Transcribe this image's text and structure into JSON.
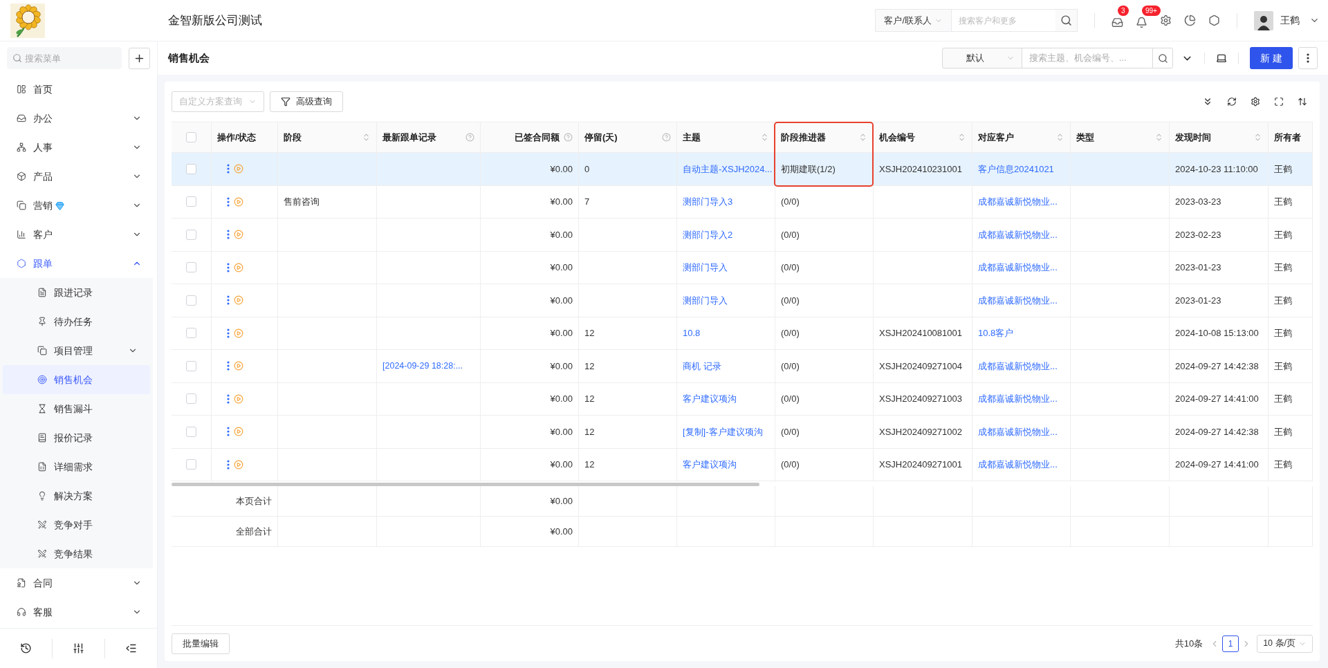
{
  "header": {
    "title": "金智新版公司测试",
    "search_scope": "客户/联系人",
    "search": {
      "placeholder": "搜索客户和更多"
    },
    "notifications": [
      {
        "count": "3"
      },
      {
        "count": "99+"
      }
    ],
    "user": {
      "name": "王鹤"
    }
  },
  "sidebar": {
    "search": {
      "placeholder": "搜索菜单"
    },
    "items": [
      {
        "label": "首页",
        "selected": false
      },
      {
        "label": "办公",
        "selected": false,
        "expanded": false
      },
      {
        "label": "人事",
        "selected": false,
        "expanded": false
      },
      {
        "label": "产品",
        "selected": false,
        "expanded": false
      },
      {
        "label": "营销",
        "selected": false,
        "expanded": false
      },
      {
        "label": "客户",
        "selected": false,
        "expanded": false
      },
      {
        "label": "跟单",
        "selected": false,
        "expanded": true,
        "children": [
          {
            "label": "跟进记录",
            "selected": false
          },
          {
            "label": "待办任务",
            "selected": false
          },
          {
            "label": "项目管理",
            "selected": false,
            "expanded": false
          },
          {
            "label": "销售机会",
            "selected": true
          },
          {
            "label": "销售漏斗",
            "selected": false
          },
          {
            "label": "报价记录",
            "selected": false
          },
          {
            "label": "详细需求",
            "selected": false
          },
          {
            "label": "解决方案",
            "selected": false
          },
          {
            "label": "竞争对手",
            "selected": false
          },
          {
            "label": "竞争结果",
            "selected": false
          }
        ]
      },
      {
        "label": "合同",
        "selected": false,
        "expanded": false
      },
      {
        "label": "客服",
        "selected": false,
        "expanded": false
      }
    ]
  },
  "page": {
    "title": "销售机会",
    "view_select": "默认",
    "search": {
      "placeholder": "搜索主题、机会编号、..."
    },
    "new_button": "新 建"
  },
  "toolbar": {
    "scheme_select": {
      "placeholder": "自定义方案查询"
    },
    "advanced_query": "高级查询"
  },
  "table": {
    "select_all": {
      "checked": false
    },
    "columns": [
      {
        "label": "操作/状态"
      },
      {
        "label": "阶段",
        "sortable": true
      },
      {
        "label": "最新跟单记录",
        "help": true
      },
      {
        "label": "已签合同额",
        "help": true
      },
      {
        "label": "停留(天)",
        "help": true
      },
      {
        "label": "主题",
        "sortable": true
      },
      {
        "label": "阶段推进器",
        "sortable": true,
        "highlighted": true
      },
      {
        "label": "机会编号",
        "sortable": true
      },
      {
        "label": "对应客户",
        "sortable": true
      },
      {
        "label": "类型",
        "sortable": true
      },
      {
        "label": "发现时间",
        "sortable": true
      },
      {
        "label": "所有者"
      }
    ],
    "rows": [
      {
        "selected": true,
        "checked": false,
        "amount": "¥0.00",
        "stay_days": "0",
        "subject": "自动主题-XSJH2024...",
        "stage_progress": "初期建联(1/2)",
        "opportunity_no": "XSJH202410231001",
        "customer": "客户信息20241021",
        "found_time": "2024-10-23 11:10:00",
        "owner": "王鹤"
      },
      {
        "selected": false,
        "checked": false,
        "stage": "售前咨询",
        "amount": "¥0.00",
        "stay_days": "7",
        "subject": "测部门导入3",
        "stage_progress": "(0/0)",
        "customer": "成都嘉诚新悦物业...",
        "found_time": "2023-03-23",
        "owner": "王鹤"
      },
      {
        "selected": false,
        "checked": false,
        "amount": "¥0.00",
        "subject": "测部门导入2",
        "stage_progress": "(0/0)",
        "customer": "成都嘉诚新悦物业...",
        "found_time": "2023-02-23",
        "owner": "王鹤"
      },
      {
        "selected": false,
        "checked": false,
        "amount": "¥0.00",
        "subject": "测部门导入",
        "stage_progress": "(0/0)",
        "customer": "成都嘉诚新悦物业...",
        "found_time": "2023-01-23",
        "owner": "王鹤"
      },
      {
        "selected": false,
        "checked": false,
        "amount": "¥0.00",
        "subject": "测部门导入",
        "stage_progress": "(0/0)",
        "customer": "成都嘉诚新悦物业...",
        "found_time": "2023-01-23",
        "owner": "王鹤"
      },
      {
        "selected": false,
        "checked": false,
        "amount": "¥0.00",
        "stay_days": "12",
        "subject": "10.8",
        "stage_progress": "(0/0)",
        "opportunity_no": "XSJH202410081001",
        "customer": "10.8客户",
        "found_time": "2024-10-08 15:13:00",
        "owner": "王鹤"
      },
      {
        "selected": false,
        "checked": false,
        "latest_record": "[2024-09-29 18:28:...",
        "amount": "¥0.00",
        "stay_days": "12",
        "subject": "商机 记录",
        "stage_progress": "(0/0)",
        "opportunity_no": "XSJH202409271004",
        "customer": "成都嘉诚新悦物业...",
        "found_time": "2024-09-27 14:42:38",
        "owner": "王鹤"
      },
      {
        "selected": false,
        "checked": false,
        "amount": "¥0.00",
        "stay_days": "12",
        "subject": "客户建议项沟",
        "stage_progress": "(0/0)",
        "opportunity_no": "XSJH202409271003",
        "customer": "成都嘉诚新悦物业...",
        "found_time": "2024-09-27 14:41:00",
        "owner": "王鹤"
      },
      {
        "selected": false,
        "checked": false,
        "amount": "¥0.00",
        "stay_days": "12",
        "subject": "[复制]-客户建议项沟",
        "stage_progress": "(0/0)",
        "opportunity_no": "XSJH202409271002",
        "customer": "成都嘉诚新悦物业...",
        "found_time": "2024-09-27 14:42:38",
        "owner": "王鹤"
      },
      {
        "selected": false,
        "checked": false,
        "amount": "¥0.00",
        "stay_days": "12",
        "subject": "客户建议项沟",
        "stage_progress": "(0/0)",
        "opportunity_no": "XSJH202409271001",
        "customer": "成都嘉诚新悦物业...",
        "found_time": "2024-09-27 14:41:00",
        "owner": "王鹤"
      }
    ],
    "summary_rows": [
      {
        "label": "本页合计",
        "amount": "¥0.00"
      },
      {
        "label": "全部合计",
        "amount": "¥0.00"
      }
    ]
  },
  "footer": {
    "batch_edit": "批量编辑",
    "total": "共10条",
    "pages": [
      {
        "label": "1",
        "selected": true
      }
    ],
    "page_size": "10 条/页"
  }
}
